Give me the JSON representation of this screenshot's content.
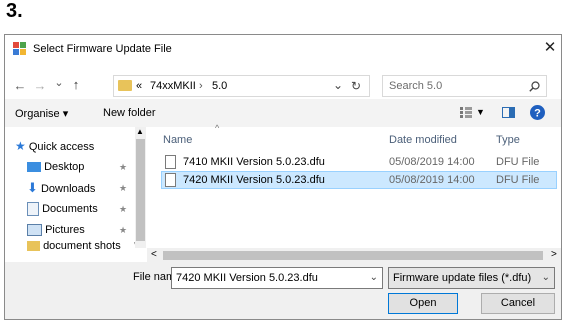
{
  "step_label": "3.",
  "window": {
    "title": "Select Firmware Update File"
  },
  "nav": {
    "back": "←",
    "forward": "→",
    "recent": "⌄",
    "up": "↑",
    "breadcrumb": [
      "«",
      "74xxMKII",
      "›",
      "5.0"
    ],
    "dropdown": "⌄",
    "refresh": "↻",
    "search_placeholder": "Search 5.0"
  },
  "toolbar": {
    "organise": "Organise ▾",
    "new_folder": "New folder"
  },
  "sidebar": {
    "items": [
      {
        "label": "Quick access",
        "icon": "star-icon"
      },
      {
        "label": "Desktop",
        "icon": "desktop-icon",
        "pin": "★"
      },
      {
        "label": "Downloads",
        "icon": "download-icon",
        "pin": "★"
      },
      {
        "label": "Documents",
        "icon": "documents-icon",
        "pin": "★"
      },
      {
        "label": "Pictures",
        "icon": "pictures-icon",
        "pin": "★"
      },
      {
        "label": "document shots",
        "icon": "folder-icon",
        "pin": "∨"
      }
    ]
  },
  "columns": {
    "name": "Name",
    "date": "Date modified",
    "type": "Type"
  },
  "files": [
    {
      "name": "7410 MKII Version 5.0.23.dfu",
      "date": "05/08/2019 14:00",
      "type": "DFU File"
    },
    {
      "name": "7420 MKII Version 5.0.23.dfu",
      "date": "05/08/2019 14:00",
      "type": "DFU File"
    }
  ],
  "footer": {
    "file_name_label": "File name:",
    "file_name_value": "7420 MKII Version 5.0.23.dfu",
    "filter": "Firmware update files (*.dfu)",
    "open": "Open",
    "cancel": "Cancel"
  },
  "colors": {
    "selection": "#cce8ff",
    "selection_border": "#99d1ff",
    "accent": "#0078d7"
  }
}
